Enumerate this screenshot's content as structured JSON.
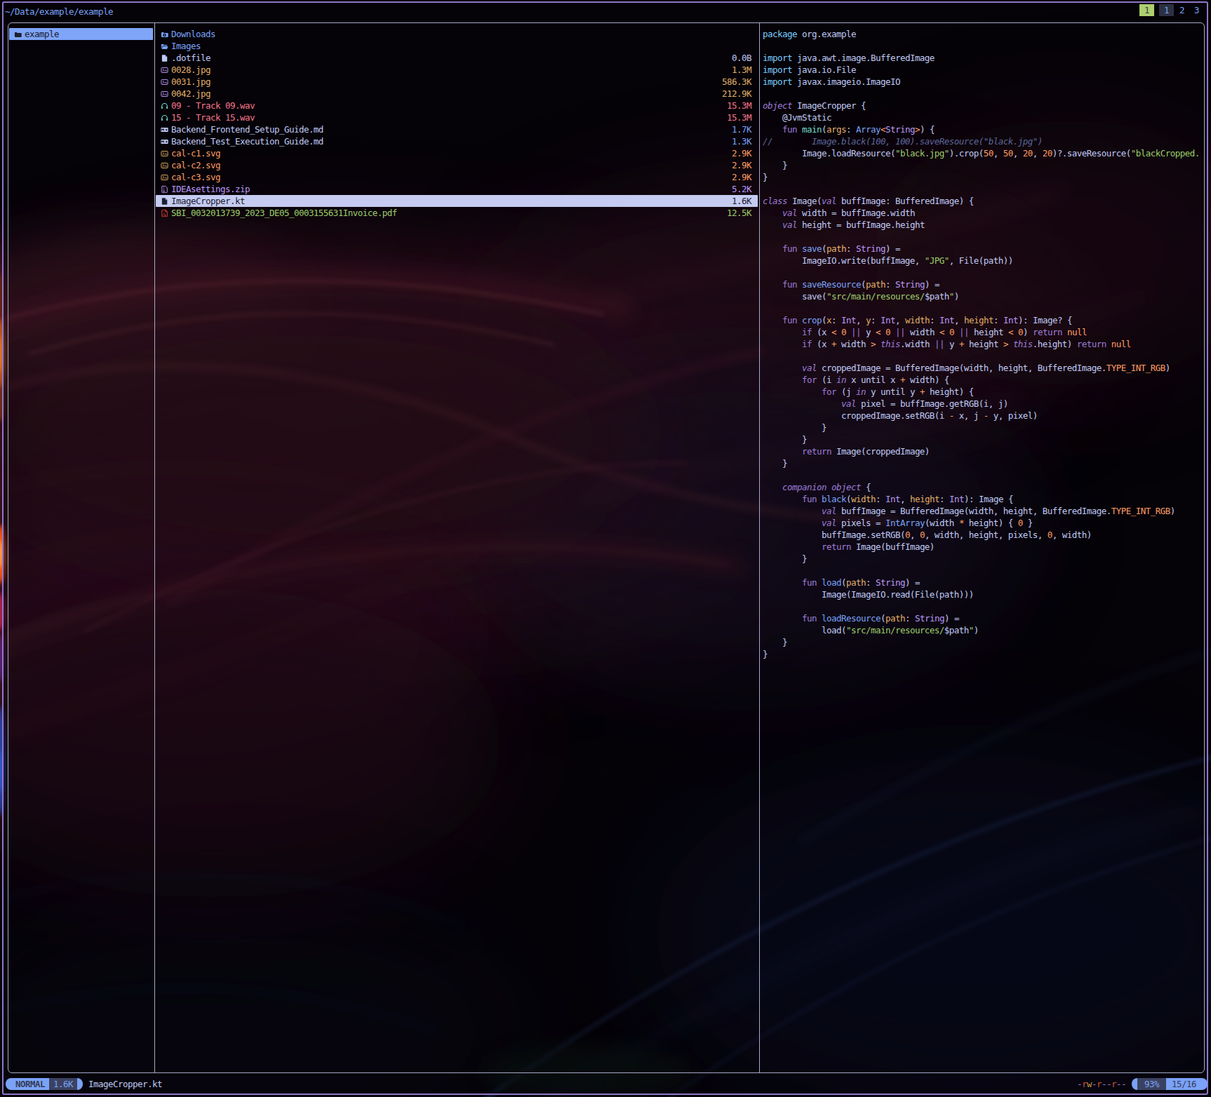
{
  "header": {
    "path": "~/Data/example/example",
    "tabs": [
      {
        "label": "1",
        "style": "active"
      },
      {
        "label": "1",
        "style": "boxed"
      },
      {
        "label": "2",
        "style": "plain"
      },
      {
        "label": "3",
        "style": "plain"
      }
    ]
  },
  "parent": {
    "items": [
      {
        "name": "example",
        "icon": "folder",
        "hovered": true,
        "color": "dark",
        "iconColor": "dark"
      }
    ]
  },
  "files": {
    "items": [
      {
        "icon": "folder-download",
        "iconColor": "blue",
        "name": "Downloads",
        "size": "",
        "color": "blue"
      },
      {
        "icon": "folder-open",
        "iconColor": "blue",
        "name": "Images",
        "size": "",
        "color": "blue"
      },
      {
        "icon": "file",
        "iconColor": "fg",
        "name": ".dotfile",
        "size": "0.0B",
        "color": "fg"
      },
      {
        "icon": "image",
        "iconColor": "violet",
        "name": "0028.jpg",
        "size": "1.3M",
        "color": "yellow"
      },
      {
        "icon": "image",
        "iconColor": "violet",
        "name": "0031.jpg",
        "size": "586.3K",
        "color": "yellow"
      },
      {
        "icon": "image",
        "iconColor": "violet",
        "name": "0042.jpg",
        "size": "212.9K",
        "color": "yellow"
      },
      {
        "icon": "headphones",
        "iconColor": "teal",
        "name": "09 - Track 09.wav",
        "size": "15.3M",
        "color": "red"
      },
      {
        "icon": "headphones",
        "iconColor": "teal",
        "name": "15 - Track 15.wav",
        "size": "15.3M",
        "color": "red"
      },
      {
        "icon": "markdown",
        "iconColor": "fg",
        "name": "Backend_Frontend_Setup_Guide.md",
        "size": "1.7K",
        "color": "fg",
        "sizeColor": "blue"
      },
      {
        "icon": "markdown",
        "iconColor": "fg",
        "name": "Backend_Test_Execution_Guide.md",
        "size": "1.3K",
        "color": "fg",
        "sizeColor": "blue"
      },
      {
        "icon": "image",
        "iconColor": "yellow",
        "name": "cal-c1.svg",
        "size": "2.9K",
        "color": "orange"
      },
      {
        "icon": "image",
        "iconColor": "yellow",
        "name": "cal-c2.svg",
        "size": "2.9K",
        "color": "orange"
      },
      {
        "icon": "image",
        "iconColor": "yellow",
        "name": "cal-c3.svg",
        "size": "2.9K",
        "color": "orange"
      },
      {
        "icon": "zip",
        "iconColor": "violet",
        "name": "IDEAsettings.zip",
        "size": "5.2K",
        "color": "violet"
      },
      {
        "icon": "kotlin",
        "iconColor": "dark",
        "name": "ImageCropper.kt",
        "size": "1.6K",
        "color": "dark",
        "hovered": true
      },
      {
        "icon": "pdf",
        "iconColor": "red2",
        "name": "SBI_0032013739_2023_DE05_0003155631Invoice.pdf",
        "size": "12.5K",
        "color": "green"
      }
    ]
  },
  "preview": {
    "file": "ImageCropper.kt",
    "language": "kotlin",
    "lines": [
      [
        [
          "inc",
          "package"
        ],
        [
          "fg",
          " org.example"
        ]
      ],
      [],
      [
        [
          "inc",
          "import"
        ],
        [
          "fg",
          " java.awt.image.BufferedImage"
        ]
      ],
      [
        [
          "inc",
          "import"
        ],
        [
          "fg",
          " java.io.File"
        ]
      ],
      [
        [
          "inc",
          "import"
        ],
        [
          "fg",
          " javax.imageio.ImageIO"
        ]
      ],
      [],
      [
        [
          "kwi",
          "object"
        ],
        [
          "fg",
          " ImageCropper {"
        ]
      ],
      [
        [
          "fg",
          "    @JvmStatic"
        ]
      ],
      [
        [
          "fg",
          "    "
        ],
        [
          "kw",
          "fun"
        ],
        [
          "fg",
          " "
        ],
        [
          "fnm",
          "main"
        ],
        [
          "fg",
          "("
        ],
        [
          "par",
          "args"
        ],
        [
          "fg",
          ": "
        ],
        [
          "fnb",
          "Array"
        ],
        [
          "op",
          "<"
        ],
        [
          "typ",
          "String"
        ],
        [
          "op",
          ">"
        ],
        [
          "fg",
          ") {"
        ]
      ],
      [
        [
          "cmt",
          "//        Image.black(100, 100).saveResource(\"black.jpg\")"
        ]
      ],
      [
        [
          "fg",
          "        Image.loadResource("
        ],
        [
          "str",
          "\"black.jpg\""
        ],
        [
          "fg",
          ").crop("
        ],
        [
          "num",
          "50"
        ],
        [
          "fg",
          ", "
        ],
        [
          "num",
          "50"
        ],
        [
          "fg",
          ", "
        ],
        [
          "num",
          "20"
        ],
        [
          "fg",
          ", "
        ],
        [
          "num",
          "20"
        ],
        [
          "fg",
          ")?.saveResource("
        ],
        [
          "str",
          "\"blackCropped."
        ]
      ],
      [
        [
          "fg",
          "    }"
        ]
      ],
      [
        [
          "fg",
          "}"
        ]
      ],
      [],
      [
        [
          "kwi",
          "class"
        ],
        [
          "fg",
          " Image("
        ],
        [
          "kwi",
          "val"
        ],
        [
          "fg",
          " buffImage: BufferedImage) {"
        ]
      ],
      [
        [
          "fg",
          "    "
        ],
        [
          "kwi",
          "val"
        ],
        [
          "fg",
          " width = buffImage.width"
        ]
      ],
      [
        [
          "fg",
          "    "
        ],
        [
          "kwi",
          "val"
        ],
        [
          "fg",
          " height = buffImage.height"
        ]
      ],
      [],
      [
        [
          "fg",
          "    "
        ],
        [
          "kw",
          "fun"
        ],
        [
          "fg",
          " "
        ],
        [
          "fnb",
          "save"
        ],
        [
          "fg",
          "("
        ],
        [
          "par",
          "path"
        ],
        [
          "fg",
          ": "
        ],
        [
          "typ",
          "String"
        ],
        [
          "fg",
          ") ="
        ]
      ],
      [
        [
          "fg",
          "        ImageIO.write(buffImage, "
        ],
        [
          "str",
          "\"JPG\""
        ],
        [
          "fg",
          ", File(path))"
        ]
      ],
      [],
      [
        [
          "fg",
          "    "
        ],
        [
          "kw",
          "fun"
        ],
        [
          "fg",
          " "
        ],
        [
          "fnb",
          "saveResource"
        ],
        [
          "fg",
          "("
        ],
        [
          "par",
          "path"
        ],
        [
          "fg",
          ": "
        ],
        [
          "typ",
          "String"
        ],
        [
          "fg",
          ") ="
        ]
      ],
      [
        [
          "fg",
          "        save("
        ],
        [
          "str",
          "\"src/main/resources/"
        ],
        [
          "fg",
          "$path"
        ],
        [
          "str",
          "\""
        ],
        [
          "fg",
          ")"
        ]
      ],
      [],
      [
        [
          "fg",
          "    "
        ],
        [
          "kw",
          "fun"
        ],
        [
          "fg",
          " "
        ],
        [
          "fnb",
          "crop"
        ],
        [
          "fg",
          "("
        ],
        [
          "par",
          "x"
        ],
        [
          "fg",
          ": "
        ],
        [
          "typ",
          "Int"
        ],
        [
          "fg",
          ", "
        ],
        [
          "par",
          "y"
        ],
        [
          "fg",
          ": "
        ],
        [
          "typ",
          "Int"
        ],
        [
          "fg",
          ", "
        ],
        [
          "par",
          "width"
        ],
        [
          "fg",
          ": "
        ],
        [
          "typ",
          "Int"
        ],
        [
          "fg",
          ", "
        ],
        [
          "par",
          "height"
        ],
        [
          "fg",
          ": "
        ],
        [
          "typ",
          "Int"
        ],
        [
          "fg",
          "): Image? {"
        ]
      ],
      [
        [
          "fg",
          "        "
        ],
        [
          "kw",
          "if"
        ],
        [
          "fg",
          " (x "
        ],
        [
          "op",
          "<"
        ],
        [
          "fg",
          " "
        ],
        [
          "num",
          "0"
        ],
        [
          "fg",
          " "
        ],
        [
          "kw2",
          "||"
        ],
        [
          "fg",
          " y "
        ],
        [
          "op",
          "<"
        ],
        [
          "fg",
          " "
        ],
        [
          "num",
          "0"
        ],
        [
          "fg",
          " "
        ],
        [
          "kw2",
          "||"
        ],
        [
          "fg",
          " width "
        ],
        [
          "op",
          "<"
        ],
        [
          "fg",
          " "
        ],
        [
          "num",
          "0"
        ],
        [
          "fg",
          " "
        ],
        [
          "kw2",
          "||"
        ],
        [
          "fg",
          " height "
        ],
        [
          "op",
          "<"
        ],
        [
          "fg",
          " "
        ],
        [
          "num",
          "0"
        ],
        [
          "fg",
          ") "
        ],
        [
          "kw",
          "return"
        ],
        [
          "fg",
          " "
        ],
        [
          "num",
          "null"
        ]
      ],
      [
        [
          "fg",
          "        "
        ],
        [
          "kw",
          "if"
        ],
        [
          "fg",
          " (x "
        ],
        [
          "op",
          "+"
        ],
        [
          "fg",
          " width "
        ],
        [
          "op",
          ">"
        ],
        [
          "fg",
          " "
        ],
        [
          "kwi",
          "this"
        ],
        [
          "fg",
          ".width "
        ],
        [
          "kw2",
          "||"
        ],
        [
          "fg",
          " y "
        ],
        [
          "op",
          "+"
        ],
        [
          "fg",
          " height "
        ],
        [
          "op",
          ">"
        ],
        [
          "fg",
          " "
        ],
        [
          "kwi",
          "this"
        ],
        [
          "fg",
          ".height) "
        ],
        [
          "kw",
          "return"
        ],
        [
          "fg",
          " "
        ],
        [
          "num",
          "null"
        ]
      ],
      [],
      [
        [
          "fg",
          "        "
        ],
        [
          "kwi",
          "val"
        ],
        [
          "fg",
          " croppedImage = BufferedImage(width, height, BufferedImage."
        ],
        [
          "num",
          "TYPE_INT_RGB"
        ],
        [
          "fg",
          ")"
        ]
      ],
      [
        [
          "fg",
          "        "
        ],
        [
          "kw",
          "for"
        ],
        [
          "fg",
          " (i "
        ],
        [
          "kwi",
          "in"
        ],
        [
          "fg",
          " x until x "
        ],
        [
          "op",
          "+"
        ],
        [
          "fg",
          " width) {"
        ]
      ],
      [
        [
          "fg",
          "            "
        ],
        [
          "kw",
          "for"
        ],
        [
          "fg",
          " (j "
        ],
        [
          "kwi",
          "in"
        ],
        [
          "fg",
          " y until y "
        ],
        [
          "op",
          "+"
        ],
        [
          "fg",
          " height) {"
        ]
      ],
      [
        [
          "fg",
          "                "
        ],
        [
          "kwi",
          "val"
        ],
        [
          "fg",
          " pixel = buffImage.getRGB(i, j)"
        ]
      ],
      [
        [
          "fg",
          "                croppedImage.setRGB(i "
        ],
        [
          "op",
          "-"
        ],
        [
          "fg",
          " x, j "
        ],
        [
          "op",
          "-"
        ],
        [
          "fg",
          " y, pixel)"
        ]
      ],
      [
        [
          "fg",
          "            }"
        ]
      ],
      [
        [
          "fg",
          "        }"
        ]
      ],
      [
        [
          "fg",
          "        "
        ],
        [
          "kw",
          "return"
        ],
        [
          "fg",
          " Image(croppedImage)"
        ]
      ],
      [
        [
          "fg",
          "    }"
        ]
      ],
      [],
      [
        [
          "fg",
          "    "
        ],
        [
          "kwi",
          "companion"
        ],
        [
          "fg",
          " "
        ],
        [
          "kwi",
          "object"
        ],
        [
          "fg",
          " {"
        ]
      ],
      [
        [
          "fg",
          "        "
        ],
        [
          "kw",
          "fun"
        ],
        [
          "fg",
          " "
        ],
        [
          "fnb",
          "black"
        ],
        [
          "fg",
          "("
        ],
        [
          "par",
          "width"
        ],
        [
          "fg",
          ": "
        ],
        [
          "typ",
          "Int"
        ],
        [
          "fg",
          ", "
        ],
        [
          "par",
          "height"
        ],
        [
          "fg",
          ": "
        ],
        [
          "typ",
          "Int"
        ],
        [
          "fg",
          "): Image {"
        ]
      ],
      [
        [
          "fg",
          "            "
        ],
        [
          "kwi",
          "val"
        ],
        [
          "fg",
          " buffImage = BufferedImage(width, height, BufferedImage."
        ],
        [
          "num",
          "TYPE_INT_RGB"
        ],
        [
          "fg",
          ")"
        ]
      ],
      [
        [
          "fg",
          "            "
        ],
        [
          "kwi",
          "val"
        ],
        [
          "fg",
          " pixels = "
        ],
        [
          "fnb",
          "IntArray"
        ],
        [
          "fg",
          "(width "
        ],
        [
          "op",
          "*"
        ],
        [
          "fg",
          " height) { "
        ],
        [
          "num",
          "0"
        ],
        [
          "fg",
          " }"
        ]
      ],
      [
        [
          "fg",
          "            buffImage.setRGB("
        ],
        [
          "num",
          "0"
        ],
        [
          "fg",
          ", "
        ],
        [
          "num",
          "0"
        ],
        [
          "fg",
          ", width, height, pixels, "
        ],
        [
          "num",
          "0"
        ],
        [
          "fg",
          ", width)"
        ]
      ],
      [
        [
          "fg",
          "            "
        ],
        [
          "kw",
          "return"
        ],
        [
          "fg",
          " Image(buffImage)"
        ]
      ],
      [
        [
          "fg",
          "        }"
        ]
      ],
      [],
      [
        [
          "fg",
          "        "
        ],
        [
          "kw",
          "fun"
        ],
        [
          "fg",
          " "
        ],
        [
          "fnb",
          "load"
        ],
        [
          "fg",
          "("
        ],
        [
          "par",
          "path"
        ],
        [
          "fg",
          ": "
        ],
        [
          "typ",
          "String"
        ],
        [
          "fg",
          ") ="
        ]
      ],
      [
        [
          "fg",
          "            Image(ImageIO.read(File(path)))"
        ]
      ],
      [],
      [
        [
          "fg",
          "        "
        ],
        [
          "kw",
          "fun"
        ],
        [
          "fg",
          " "
        ],
        [
          "fnb",
          "loadResource"
        ],
        [
          "fg",
          "("
        ],
        [
          "par",
          "path"
        ],
        [
          "fg",
          ": "
        ],
        [
          "typ",
          "String"
        ],
        [
          "fg",
          ") ="
        ]
      ],
      [
        [
          "fg",
          "            load("
        ],
        [
          "str",
          "\"src/main/resources/"
        ],
        [
          "fg",
          "$path"
        ],
        [
          "str",
          "\""
        ],
        [
          "fg",
          ")"
        ]
      ],
      [
        [
          "fg",
          "    }"
        ]
      ],
      [
        [
          "fg",
          "}"
        ]
      ]
    ]
  },
  "status": {
    "mode": "NORMAL",
    "file_size": "1.6K",
    "file_name": "ImageCropper.kt",
    "permissions": "-rw-r--r--",
    "percent": "93%",
    "position": "15/16"
  },
  "colors": {
    "blue": "#7aa2f7",
    "fg": "#c0caf5",
    "yellow": "#e0af68",
    "orange": "#ff9e64",
    "red": "#f7768e",
    "red2": "#cf3e36",
    "green": "#9ece6a",
    "teal": "#73daca",
    "violet": "#bb9af7",
    "purple": "#9d7cd8",
    "cyan": "#7dcfff",
    "comment": "#5d6699",
    "dark": "#1c2030",
    "hoverBg": "#c5cbf1",
    "parentHoverBg": "#7ea5f8",
    "slate": "#3b4261",
    "tabActiveBg": "#aecf6e",
    "tabBoxBg": "#2b3042",
    "permR": "#d1503c",
    "permW": "#c19a3f",
    "permDash": "#9a7ecc",
    "border": "#a6a9c6",
    "termBorder": "#8f77c9"
  }
}
